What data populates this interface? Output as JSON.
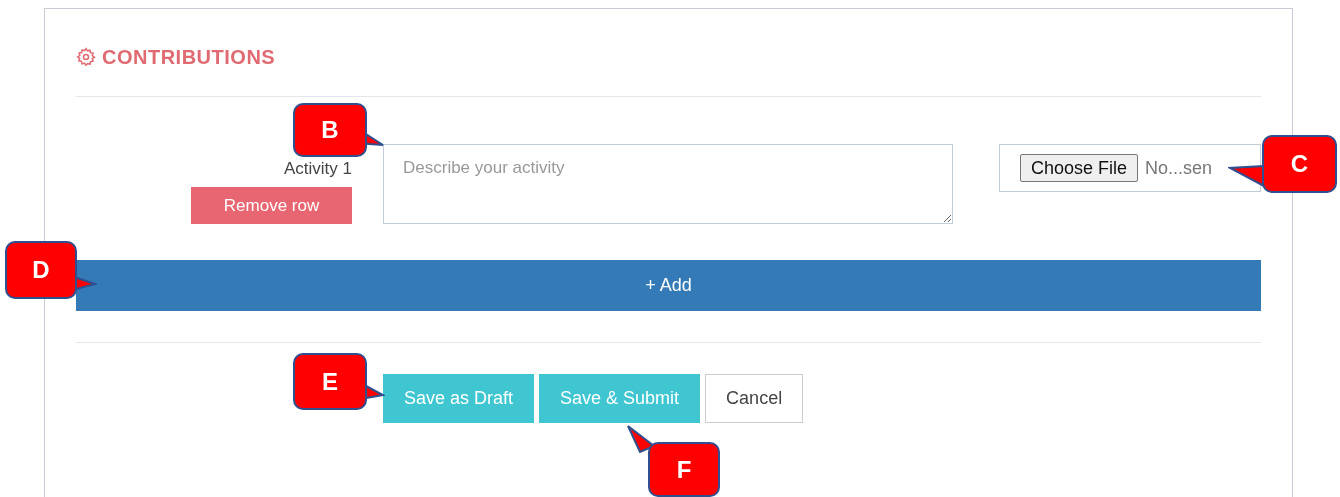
{
  "section": {
    "title": "CONTRIBUTIONS"
  },
  "rows": [
    {
      "label": "Activity 1",
      "remove_button": "Remove row",
      "description_placeholder": "Describe your activity",
      "file_button": "Choose File",
      "file_status": "No...sen"
    }
  ],
  "add_button": "+ Add",
  "actions": [
    {
      "label": "Save as Draft",
      "kind": "primary"
    },
    {
      "label": "Save & Submit",
      "kind": "primary"
    },
    {
      "label": "Cancel",
      "kind": "secondary"
    }
  ],
  "callouts": [
    {
      "letter": "B"
    },
    {
      "letter": "C"
    },
    {
      "letter": "D"
    },
    {
      "letter": "E"
    },
    {
      "letter": "F"
    }
  ]
}
